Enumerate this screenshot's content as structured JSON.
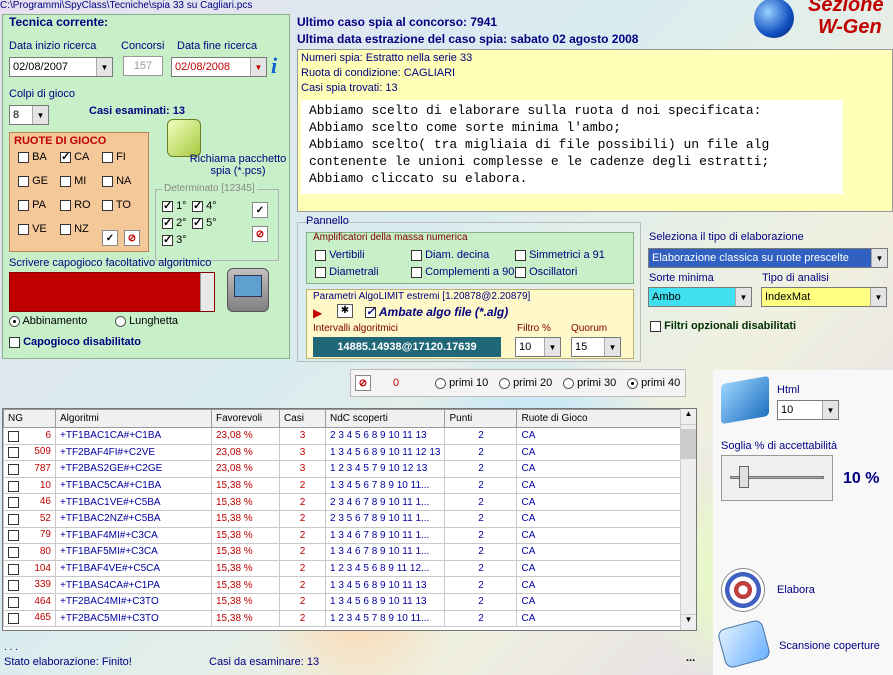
{
  "window": {
    "path": "C:\\Programmi\\SpyClass\\Tecniche\\spia 33 su Cagliari.pcs"
  },
  "brand": {
    "line1": "Sezione",
    "line2": "W-Gen"
  },
  "tecnica": {
    "title": "Tecnica corrente:",
    "data_inizio_label": "Data inizio ricerca",
    "data_inizio": "02/08/2007",
    "concorsi_label": "Concorsi",
    "concorsi": "157",
    "data_fine_label": "Data fine ricerca",
    "data_fine": "02/08/2008",
    "colpi_label": "Colpi di gioco",
    "colpi": "8",
    "casi_esaminati": "Casi esaminati: 13",
    "ruote_title": "RUOTE DI GIOCO",
    "ruote": [
      {
        "name": "BA",
        "on": false
      },
      {
        "name": "CA",
        "on": true
      },
      {
        "name": "FI",
        "on": false
      },
      {
        "name": "GE",
        "on": false
      },
      {
        "name": "MI",
        "on": false
      },
      {
        "name": "NA",
        "on": false
      },
      {
        "name": "PA",
        "on": false
      },
      {
        "name": "RO",
        "on": false
      },
      {
        "name": "TO",
        "on": false
      },
      {
        "name": "VE",
        "on": false
      },
      {
        "name": "NZ",
        "on": false
      }
    ],
    "richiama": "Richiama pacchetto spia (*.pcs)",
    "determinato_title": "Determinato [12345]",
    "det": [
      "1°",
      "4°",
      "2°",
      "5°",
      "3°"
    ],
    "capogioco_label": "Scrivere capogioco facoltativo algoritmico",
    "abbinamento": "Abbinamento",
    "lunghetta": "Lunghetta",
    "capogioco_dis": "Capogioco disabilitato"
  },
  "header": {
    "ultimo": "Ultimo caso spia al concorso: 7941",
    "ultima_data": "Ultima data estrazione del caso spia: sabato 02 agosto 2008"
  },
  "info": {
    "line1": "Numeri spia: Estratto nella serie 33",
    "line2": "Ruota di condizione: CAGLIARI",
    "line3": "Casi spia trovati: 13",
    "memo": [
      "Abbiamo scelto di elaborare sulla ruota d noi specificata:",
      "Abbiamo scelto come sorte minima l'ambo;",
      "Abbiamo scelto( tra migliaia di file possibili) un file alg",
      "contenente le unioni complesse e le cadenze degli estratti;",
      "Abbiamo cliccato su elabora."
    ]
  },
  "pannello": {
    "title": "Pannello",
    "amp_title": "Amplificatori della massa numerica",
    "amp": [
      "Vertibili",
      "Diam. decina",
      "Simmetrici a 91",
      "Diametrali",
      "Complementi a 90",
      "Oscillatori"
    ],
    "algo_title": "Parametri AlgoLIMIT estremi [1.20878@2.20879]",
    "ambate": "Ambate algo file (*.alg)",
    "intervalli_label": "Intervalli algoritmici",
    "intervalli": "14885.14938@17120.17639",
    "filtro_label": "Filtro %",
    "filtro": "10",
    "quorum_label": "Quorum",
    "quorum": "15"
  },
  "elab": {
    "tipo_label": "Seleziona il tipo di elaborazione",
    "tipo": "Elaborazione classica su ruote prescelte",
    "sorte_label": "Sorte minima",
    "sorte": "Ambo",
    "analisi_label": "Tipo di analisi",
    "analisi": "IndexMat",
    "filtri": "Filtri opzionali disabilitati"
  },
  "primi": {
    "count": "0",
    "options": [
      "primi 10",
      "primi 20",
      "primi 30",
      "primi 40"
    ]
  },
  "table": {
    "headers": [
      "NG",
      "Algoritmi",
      "Favorevoli",
      "Casi",
      "NdC scoperti",
      "Punti",
      "Ruote di Gioco"
    ],
    "rows": [
      [
        "6",
        "+TF1BAC1CA#+C1BA",
        "23,08 %",
        "3",
        "2 3 4 5 6 8 9 10 11 13",
        "2",
        "CA"
      ],
      [
        "509",
        "+TF2BAF4FI#+C2VE",
        "23,08 %",
        "3",
        "1 3 4 5 6 8 9 10 11 12 13",
        "2",
        "CA"
      ],
      [
        "787",
        "+TF2BAS2GE#+C2GE",
        "23,08 %",
        "3",
        "1 2 3 4 5 7 9 10 12 13",
        "2",
        "CA"
      ],
      [
        "10",
        "+TF1BAC5CA#+C1BA",
        "15,38 %",
        "2",
        "1 3 4 5 6 7 8 9 10 11...",
        "2",
        "CA"
      ],
      [
        "46",
        "+TF1BAC1VE#+C5BA",
        "15,38 %",
        "2",
        "2 3 4 6 7 8 9 10 11 1...",
        "2",
        "CA"
      ],
      [
        "52",
        "+TF1BAC2NZ#+C5BA",
        "15,38 %",
        "2",
        "2 3 5 6 7 8 9 10 11 1...",
        "2",
        "CA"
      ],
      [
        "79",
        "+TF1BAF4MI#+C3CA",
        "15,38 %",
        "2",
        "1 3 4 6 7 8 9 10 11 1...",
        "2",
        "CA"
      ],
      [
        "80",
        "+TF1BAF5MI#+C3CA",
        "15,38 %",
        "2",
        "1 3 4 6 7 8 9 10 11 1...",
        "2",
        "CA"
      ],
      [
        "104",
        "+TF1BAF4VE#+C5CA",
        "15,38 %",
        "2",
        "1 2 3 4 5 6 8 9 11 12...",
        "2",
        "CA"
      ],
      [
        "339",
        "+TF1BAS4CA#+C1PA",
        "15,38 %",
        "2",
        "1 3 4 5 6 8 9 10 11 13",
        "2",
        "CA"
      ],
      [
        "464",
        "+TF2BAC4MI#+C3TO",
        "15,38 %",
        "2",
        "1 3 4 5 6 8 9 10 11 13",
        "2",
        "CA"
      ],
      [
        "465",
        "+TF2BAC5MI#+C3TO",
        "15,38 %",
        "2",
        "1 2 3 4 5 7 8 9 10 11...",
        "2",
        "CA"
      ]
    ]
  },
  "right": {
    "html_label": "Html",
    "html_val": "10",
    "soglia_label": "Soglia % di accettabilità",
    "soglia_val": "10 %",
    "soglia_level": 0.1,
    "elabora": "Elabora",
    "scansione": "Scansione coperture"
  },
  "status": {
    "dots": ". . .",
    "stato": "Stato elaborazione:  Finito!",
    "casi": "Casi da esaminare: 13",
    "ell": "..."
  }
}
